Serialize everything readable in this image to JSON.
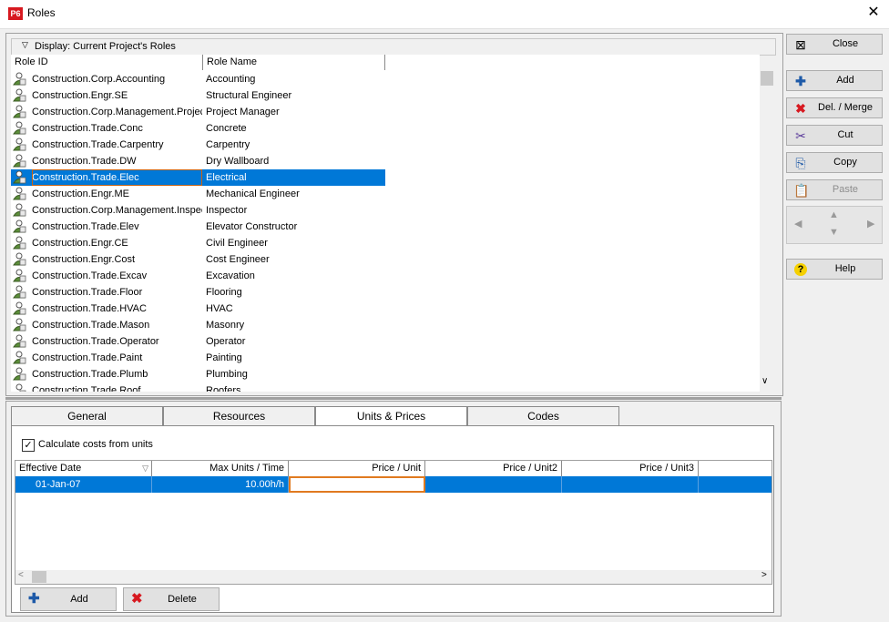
{
  "window": {
    "app_badge": "P6",
    "title": "Roles",
    "close_glyph": "✕"
  },
  "roles": {
    "display_label": "Display: Current Project's Roles",
    "columns": [
      "Role ID",
      "Role Name"
    ],
    "rows": [
      {
        "id": "Construction.Corp.Accounting",
        "name": "Accounting"
      },
      {
        "id": "Construction.Engr.SE",
        "name": "Structural Engineer"
      },
      {
        "id": "Construction.Corp.Management.Project",
        "name": "Project Manager"
      },
      {
        "id": "Construction.Trade.Conc",
        "name": "Concrete"
      },
      {
        "id": "Construction.Trade.Carpentry",
        "name": "Carpentry"
      },
      {
        "id": "Construction.Trade.DW",
        "name": "Dry Wallboard"
      },
      {
        "id": "Construction.Trade.Elec",
        "name": "Electrical",
        "selected": true
      },
      {
        "id": "Construction.Engr.ME",
        "name": "Mechanical Engineer"
      },
      {
        "id": "Construction.Corp.Management.Inspect",
        "name": "Inspector"
      },
      {
        "id": "Construction.Trade.Elev",
        "name": "Elevator Constructor"
      },
      {
        "id": "Construction.Engr.CE",
        "name": "Civil Engineer"
      },
      {
        "id": "Construction.Engr.Cost",
        "name": "Cost Engineer"
      },
      {
        "id": "Construction.Trade.Excav",
        "name": "Excavation"
      },
      {
        "id": "Construction.Trade.Floor",
        "name": "Flooring"
      },
      {
        "id": "Construction.Trade.HVAC",
        "name": "HVAC"
      },
      {
        "id": "Construction.Trade.Mason",
        "name": "Masonry"
      },
      {
        "id": "Construction.Trade.Operator",
        "name": "Operator"
      },
      {
        "id": "Construction.Trade.Paint",
        "name": "Painting"
      },
      {
        "id": "Construction.Trade.Plumb",
        "name": "Plumbing"
      },
      {
        "id": "Construction.Trade.Roof",
        "name": "Roofers"
      }
    ]
  },
  "side_buttons": {
    "close": "Close",
    "add": "Add",
    "del_merge": "Del. / Merge",
    "cut": "Cut",
    "copy": "Copy",
    "paste": "Paste",
    "help": "Help"
  },
  "tabs": [
    "General",
    "Resources",
    "Units & Prices",
    "Codes"
  ],
  "units_prices": {
    "calc_label": "Calculate costs from units",
    "calc_checked": "✓",
    "columns": [
      "Effective Date",
      "Max Units / Time",
      "Price / Unit",
      "Price / Unit2",
      "Price / Unit3"
    ],
    "row": {
      "date": "01-Jan-07",
      "max_units": "10.00h/h",
      "price1": "",
      "price2": "",
      "price3": ""
    }
  },
  "bottom_buttons": {
    "add": "Add",
    "delete": "Delete"
  },
  "colors": {
    "selection": "#0078d7",
    "focus_outline": "#c86414",
    "badge": "#d71920"
  }
}
